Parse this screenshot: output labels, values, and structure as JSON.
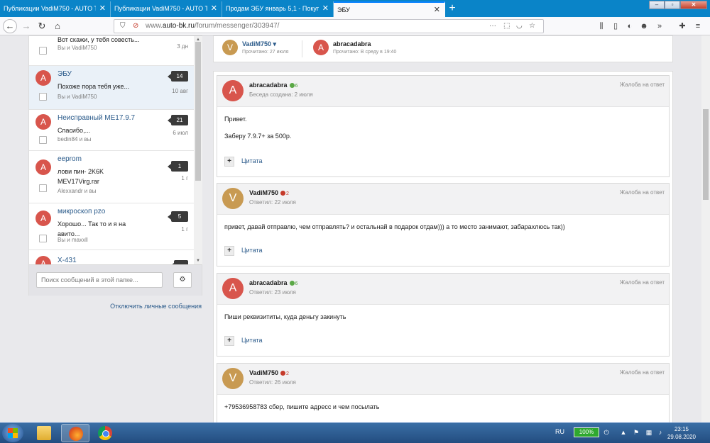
{
  "browser": {
    "tabs": [
      {
        "label": "Публикации VadiM750 - AUTO TE"
      },
      {
        "label": "Публикации VadiM750 - AUTO TE"
      },
      {
        "label": "Продам ЭБУ январь 5,1 - Покупка"
      },
      {
        "label": "ЭБУ"
      }
    ],
    "new_tab_label": "+",
    "url_prefix": "www.",
    "url_domain": "auto-bk.ru",
    "url_path": "/forum/messenger/303947/"
  },
  "sidebar": {
    "conversations": [
      {
        "avatar": "",
        "title": "",
        "preview": "Вот скажи, у тебя совесть...",
        "participants": "Вы и VadiM750",
        "count": "",
        "date": "3 дн"
      },
      {
        "avatar": "A",
        "title": "ЭБУ",
        "preview": "Похоже пора тебя уже...",
        "participants": "Вы и VadiM750",
        "count": "14",
        "date": "10 авг"
      },
      {
        "avatar": "A",
        "title": "Неисправный ME17.9.7",
        "preview": "Спасибо,...",
        "participants": "bedin84 и вы",
        "count": "21",
        "date": "6 июл"
      },
      {
        "avatar": "A",
        "title": "eeprom",
        "preview": "лови  пин- 2K6K MEV17Virg.rar",
        "participants": "Alexxandr и вы",
        "count": "1",
        "date": "1 г"
      },
      {
        "avatar": "A",
        "title": "микроскоп pzo",
        "preview": "Хорошо... Так то и я на авито...",
        "participants": "Вы и maxxll",
        "count": "5",
        "date": "1 г"
      },
      {
        "avatar": "A",
        "title": "X-431",
        "preview": "",
        "participants": "",
        "count": "",
        "date": ""
      }
    ],
    "search_placeholder": "Поиск сообщений в этой папке...",
    "disable_link": "Отключить личные сообщения"
  },
  "header": {
    "participants": [
      {
        "avatar": "V",
        "name": "VadiM750",
        "dropdown": "▾",
        "read": "Прочитано: 27 июля"
      },
      {
        "avatar": "A",
        "name": "abracadabra",
        "read": "Прочитано: В среду в 19:40"
      }
    ]
  },
  "messages": [
    {
      "avatar": "A",
      "author": "abracadabra",
      "rep": "6",
      "rep_type": "pos",
      "status": "Беседа создана: 2 июля",
      "report": "Жалоба на ответ",
      "lines": [
        "Привет.",
        "Заберу 7.9.7+ за 500р."
      ],
      "quote": "Цитата"
    },
    {
      "avatar": "V",
      "author": "VadiM750",
      "rep": "2",
      "rep_type": "neg",
      "status": "Ответил: 22 июля",
      "report": "Жалоба на ответ",
      "lines": [
        "привет, давай отправлю, чем отправлять? и остальнай в подарок отдам))) а то место занимают, забарахлюсь так))"
      ],
      "quote": "Цитата"
    },
    {
      "avatar": "A",
      "author": "abracadabra",
      "rep": "6",
      "rep_type": "pos",
      "status": "Ответил: 23 июля",
      "report": "Жалоба на ответ",
      "lines": [
        "Пиши реквизититы, куда деньгу закинуть"
      ],
      "quote": "Цитата"
    },
    {
      "avatar": "V",
      "author": "VadiM750",
      "rep": "2",
      "rep_type": "neg",
      "status": "Ответил: 26 июля",
      "report": "Жалоба на ответ",
      "lines": [
        "+79536958783 сбер, пишите адресс и чем посылать"
      ],
      "quote": ""
    }
  ],
  "taskbar": {
    "lang": "RU",
    "battery": "100%",
    "time": "23:15",
    "date": "29.08.2020"
  },
  "colors": {
    "tabstrip": "#0a84c8",
    "avatar_a": "#d8554c",
    "avatar_v": "#c89a52",
    "link": "#2a5a8a",
    "rep_positive": "#4c9c3a",
    "rep_negative": "#c53a2a"
  },
  "icons": {
    "back": "back-arrow-icon",
    "forward": "forward-arrow-icon",
    "reload": "reload-icon",
    "home": "home-icon",
    "shield": "shield-icon",
    "gear": "gear-icon",
    "close": "close-icon"
  }
}
